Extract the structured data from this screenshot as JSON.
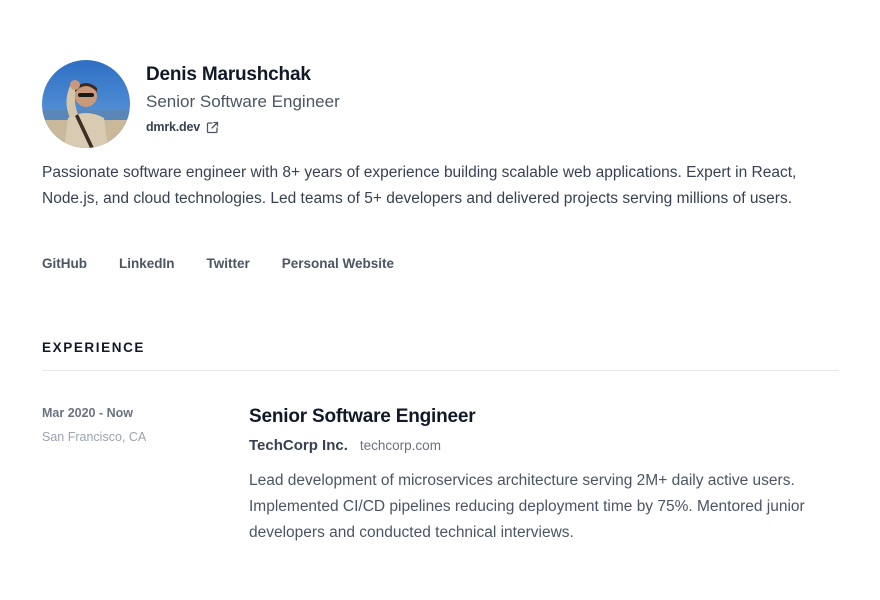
{
  "profile": {
    "name": "Denis Marushchak",
    "title": "Senior Software Engineer",
    "website": "dmrk.dev",
    "summary": "Passionate software engineer with 8+ years of experience building scalable web applications. Expert in React, Node.js, and cloud technologies. Led teams of 5+ developers and delivered projects serving millions of users."
  },
  "links": [
    {
      "label": "GitHub"
    },
    {
      "label": "LinkedIn"
    },
    {
      "label": "Twitter"
    },
    {
      "label": "Personal Website"
    }
  ],
  "experience": {
    "heading": "EXPERIENCE",
    "jobs": [
      {
        "dates": "Mar 2020 - Now",
        "location": "San Francisco, CA",
        "title": "Senior Software Engineer",
        "company": "TechCorp Inc.",
        "company_site": "techcorp.com",
        "description": "Lead development of microservices architecture serving 2M+ daily active users. Implemented CI/CD pipelines reducing deployment time by 75%. Mentored junior developers and conducted technical interviews."
      }
    ]
  },
  "icons": {
    "website_link": "external-link-icon",
    "avatar": "avatar-photo"
  }
}
